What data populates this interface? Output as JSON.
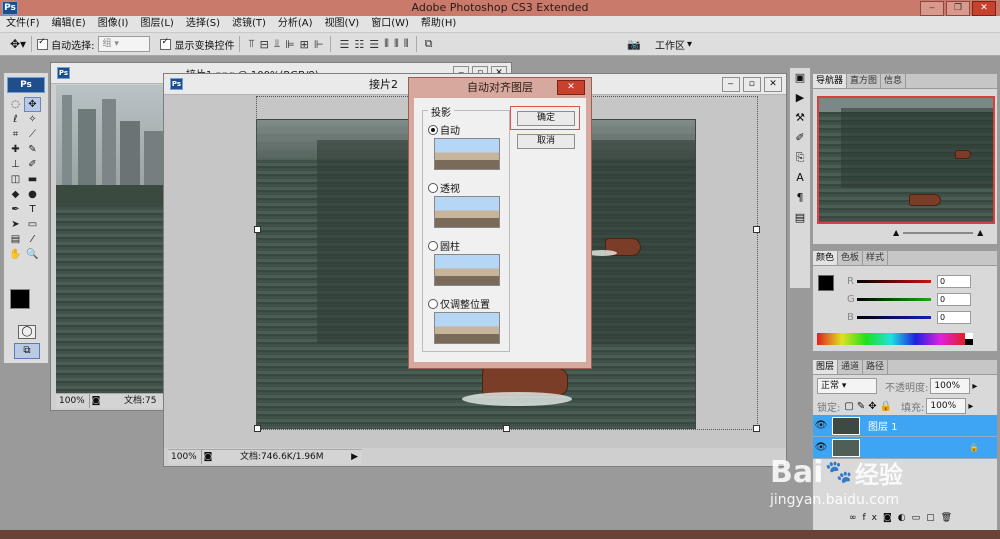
{
  "app": {
    "title": "Adobe Photoshop CS3 Extended",
    "logo": "Ps"
  },
  "menu": [
    "文件(F)",
    "编辑(E)",
    "图像(I)",
    "图层(L)",
    "选择(S)",
    "滤镜(T)",
    "分析(A)",
    "视图(V)",
    "窗口(W)",
    "帮助(H)"
  ],
  "options": {
    "auto_select_label": "自动选择:",
    "auto_select_value": "组",
    "show_transform_label": "显示变换控件",
    "workspace_label": "工作区"
  },
  "doc1": {
    "title": "接片1.png @ 100%(RGB/8)",
    "zoom": "100%",
    "status": "文档:75"
  },
  "doc2": {
    "title": "接片2",
    "zoom": "100%",
    "status": "文档:746.6K/1.96M"
  },
  "dialog": {
    "title": "自动对齐图层",
    "group_label": "投影",
    "options": [
      {
        "label": "自动",
        "selected": true
      },
      {
        "label": "透视",
        "selected": false
      },
      {
        "label": "圆柱",
        "selected": false
      },
      {
        "label": "仅调整位置",
        "selected": false
      }
    ],
    "ok_label": "确定",
    "cancel_label": "取消"
  },
  "navigator": {
    "tabs": [
      "导航器",
      "直方图",
      "信息"
    ]
  },
  "color_panel": {
    "tabs": [
      "颜色",
      "色板",
      "样式"
    ],
    "channels": [
      {
        "label": "R",
        "value": "0",
        "color": "#d01010"
      },
      {
        "label": "G",
        "value": "0",
        "color": "#10b010"
      },
      {
        "label": "B",
        "value": "0",
        "color": "#1020c0"
      }
    ]
  },
  "layers_panel": {
    "tabs": [
      "图层",
      "通道",
      "路径"
    ],
    "blend_mode": "正常",
    "opacity_label": "不透明度:",
    "opacity_value": "100%",
    "lock_label": "锁定:",
    "fill_label": "填充:",
    "fill_value": "100%",
    "layers": [
      {
        "name": "图层 1",
        "selected": true
      },
      {
        "name": "",
        "selected": true,
        "locked": true
      }
    ]
  },
  "watermark": {
    "brand": "Bai",
    "brand2": "经验",
    "url": "jingyan.baidu.com"
  },
  "colors": {
    "titlebar": "#c97a6b",
    "dialog": "#d7a99e",
    "selection": "#3da5f4",
    "ok_highlight": "#e05050"
  }
}
